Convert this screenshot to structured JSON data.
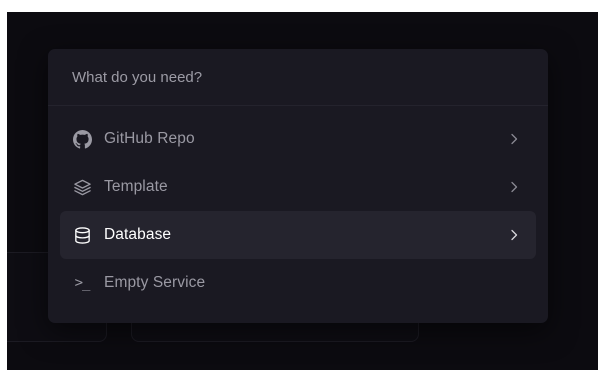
{
  "search": {
    "placeholder": "What do you need?"
  },
  "menu": {
    "items": [
      {
        "label": "GitHub Repo",
        "icon": "github-icon",
        "selected": false
      },
      {
        "label": "Template",
        "icon": "layers-icon",
        "selected": false
      },
      {
        "label": "Database",
        "icon": "database-icon",
        "selected": true
      },
      {
        "label": "Empty Service",
        "icon": "terminal-prompt-icon",
        "selected": false
      }
    ]
  },
  "colors": {
    "background": "#0c0b10",
    "dialog": "#1a1922",
    "selected_row": "#25242e",
    "text_muted": "#9a99a3",
    "text_selected": "#ffffff"
  }
}
